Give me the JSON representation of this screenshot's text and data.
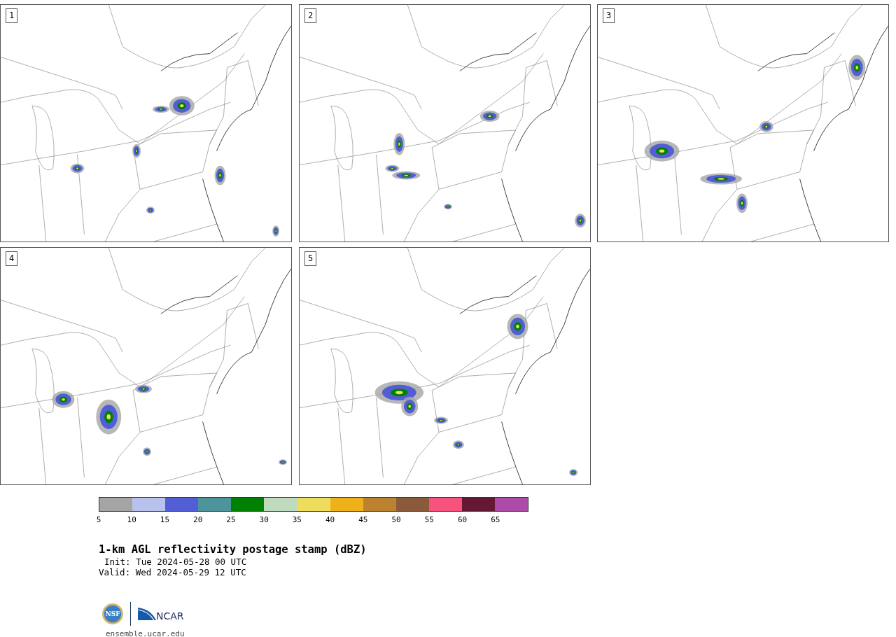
{
  "panels": [
    {
      "label": "1"
    },
    {
      "label": "2"
    },
    {
      "label": "3"
    },
    {
      "label": "4"
    },
    {
      "label": "5"
    }
  ],
  "colorbar": {
    "bins": [
      {
        "color": "#a5a5a5",
        "label": "5"
      },
      {
        "color": "#b8c2ec",
        "label": "10"
      },
      {
        "color": "#525ed5",
        "label": "15"
      },
      {
        "color": "#4d959b",
        "label": "20"
      },
      {
        "color": "#018101",
        "label": "25"
      },
      {
        "color": "#bedcbd",
        "label": "30"
      },
      {
        "color": "#eedc5d",
        "label": "35"
      },
      {
        "color": "#efb11a",
        "label": "40"
      },
      {
        "color": "#bb8330",
        "label": "45"
      },
      {
        "color": "#8b5a3b",
        "label": "50"
      },
      {
        "color": "#f6527d",
        "label": "55"
      },
      {
        "color": "#631834",
        "label": "60"
      },
      {
        "color": "#ae4aa8",
        "label": "65"
      }
    ]
  },
  "title": "1-km AGL reflectivity postage stamp (dBZ)",
  "init": "Init: Tue 2024-05-28 00 UTC",
  "valid": "Valid: Wed 2024-05-29 12 UTC",
  "logo": {
    "nsf": "NSF",
    "ncar": "NCAR"
  },
  "url": "ensemble.ucar.edu"
}
